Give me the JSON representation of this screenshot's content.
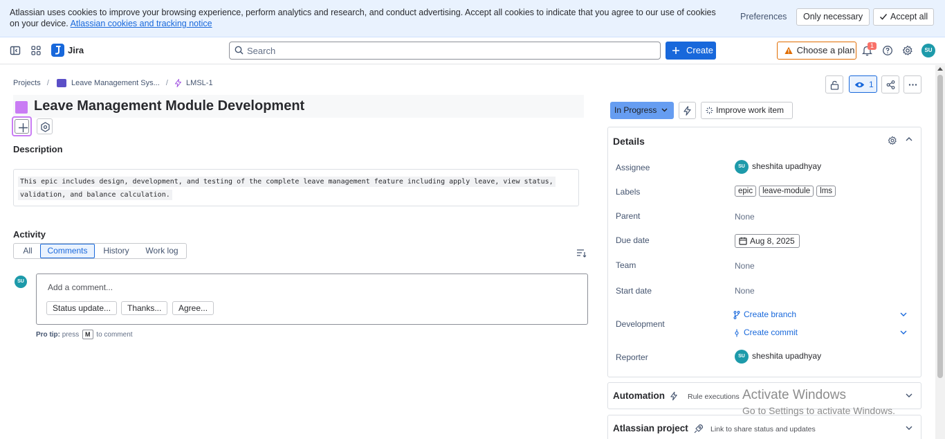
{
  "cookie_banner": {
    "text": "Atlassian uses cookies to improve your browsing experience, perform analytics and research, and conduct advertising. Accept all cookies to indicate that you agree to our use of cookies on your device.",
    "link": "Atlassian cookies and tracking notice",
    "preferences": "Preferences",
    "only_necessary": "Only necessary",
    "accept_all": "Accept all"
  },
  "nav": {
    "app_name": "Jira",
    "search_placeholder": "Search",
    "create": "Create",
    "choose_plan": "Choose a plan",
    "notif_count": "1",
    "user_initials": "SU"
  },
  "breadcrumbs": {
    "projects": "Projects",
    "project_name": "Leave Management Sys...",
    "issue_key": "LMSL-1",
    "separator": "/"
  },
  "issue": {
    "title": "Leave Management Module Development",
    "description_heading": "Description",
    "description_line1": "This epic includes design, development, and testing of the complete leave management feature including apply leave, view status,",
    "description_line2": "validation, and balance calculation."
  },
  "activity": {
    "heading": "Activity",
    "tabs": [
      "All",
      "Comments",
      "History",
      "Work log"
    ],
    "active_tab": "Comments",
    "comment_placeholder": "Add a comment...",
    "quick_replies": [
      "Status update...",
      "Thanks...",
      "Agree..."
    ],
    "protip_label": "Pro tip:",
    "protip_press": "press",
    "protip_key": "M",
    "protip_suffix": "to comment"
  },
  "actions": {
    "watch_count": "1",
    "status": "In Progress",
    "improve": "Improve work item"
  },
  "details": {
    "heading": "Details",
    "rows": {
      "assignee_label": "Assignee",
      "assignee": "sheshita upadhyay",
      "labels_label": "Labels",
      "labels": [
        "epic",
        "leave-module",
        "lms"
      ],
      "parent_label": "Parent",
      "parent": "None",
      "due_label": "Due date",
      "due": "Aug 8, 2025",
      "team_label": "Team",
      "team": "None",
      "start_label": "Start date",
      "start": "None",
      "dev_label": "Development",
      "create_branch": "Create branch",
      "create_commit": "Create commit",
      "reporter_label": "Reporter",
      "reporter": "sheshita upadhyay"
    }
  },
  "panels": {
    "automation": "Automation",
    "automation_sub": "Rule executions",
    "atlassian_project": "Atlassian project",
    "atlassian_project_sub": "Link to share status and updates"
  },
  "watermark": {
    "line1": "Activate Windows",
    "line2": "Go to Settings to activate Windows."
  },
  "colors": {
    "brand": "#1868db",
    "epic": "#c97cf4",
    "status": "#669df1",
    "warning": "#e06c00"
  }
}
